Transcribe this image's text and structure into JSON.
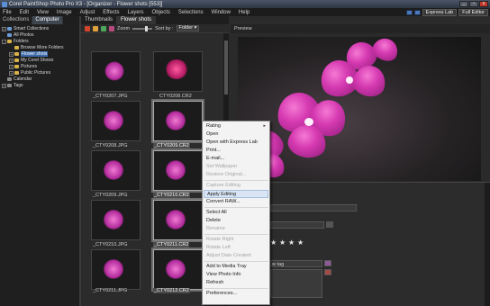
{
  "window": {
    "title": "Corel PaintShop Photo Pro X3 - [Organizer - Flower shots [553]]",
    "controls": [
      "_",
      "▫",
      "x"
    ]
  },
  "menu": {
    "items": [
      "File",
      "Edit",
      "View",
      "Image",
      "Adjust",
      "Effects",
      "Layers",
      "Objects",
      "Selections",
      "Window",
      "Help"
    ],
    "modes": [
      "Express Lab",
      "Full Editor"
    ]
  },
  "left_tabs": [
    "Collections",
    "Computer"
  ],
  "tree": [
    {
      "label": "Smart Collections",
      "expander": "+",
      "icon": "folder-icon"
    },
    {
      "label": "All Photos",
      "expander": "",
      "icon": "photos-icon"
    },
    {
      "label": "Folders",
      "expander": "-",
      "icon": "folder-icon"
    },
    {
      "label": "Browse More Folders",
      "expander": "",
      "icon": "folder-icon"
    },
    {
      "label": "Flower shots",
      "expander": "+",
      "icon": "folder-icon"
    },
    {
      "label": "My Corel Shows",
      "expander": "+",
      "icon": "folder-icon"
    },
    {
      "label": "Pictures",
      "expander": "+",
      "icon": "folder-icon"
    },
    {
      "label": "Public Pictures",
      "expander": "+",
      "icon": "folder-icon"
    },
    {
      "label": "Calendar",
      "expander": "",
      "icon": "calendar-icon"
    },
    {
      "label": "Tags",
      "expander": "+",
      "icon": "tag-icon"
    }
  ],
  "mid_tabs": [
    "Thumbnails",
    "Flower shots"
  ],
  "toolbar": {
    "zoom_label": "Zoom",
    "sort_label": "Sort by :",
    "sort_value": "Folder ▾"
  },
  "thumbnails": [
    {
      "caption": "_CTY0207.JPG",
      "selected": false
    },
    {
      "caption": "CTY0208.CR2",
      "selected": false
    },
    {
      "caption": "_CTY0208.JPG",
      "selected": false
    },
    {
      "caption": "_CTY0209.CR2",
      "selected": true
    },
    {
      "caption": "_CTY0209.JPG",
      "selected": false
    },
    {
      "caption": "_CTY0210.CR2",
      "selected": true
    },
    {
      "caption": "_CTY0210.JPG",
      "selected": false
    },
    {
      "caption": "_CTY0211.CR2",
      "selected": true
    },
    {
      "caption": "_CTY0211.JPG",
      "selected": false
    },
    {
      "caption": "_CTY0212.CR2",
      "selected": true
    }
  ],
  "preview": {
    "label": "Preview"
  },
  "info": {
    "tag_placeholder": "w tag",
    "rating_stars": 5
  },
  "context_menu": [
    {
      "label": "Rating",
      "disabled": false,
      "submenu": true
    },
    {
      "label": "Open",
      "disabled": false
    },
    {
      "label": "Open with Express Lab",
      "disabled": false
    },
    {
      "label": "Print...",
      "disabled": false
    },
    {
      "label": "E-mail...",
      "disabled": false
    },
    {
      "label": "Set Wallpaper",
      "disabled": true
    },
    {
      "label": "Restore Original...",
      "disabled": true
    },
    {
      "separator": true
    },
    {
      "label": "Capture Editing",
      "disabled": true
    },
    {
      "label": "Apply Editing",
      "disabled": false,
      "highlight": true
    },
    {
      "label": "Convert RAW...",
      "disabled": false
    },
    {
      "separator": true
    },
    {
      "label": "Select All",
      "disabled": false
    },
    {
      "label": "Delete",
      "disabled": false
    },
    {
      "label": "Rename",
      "disabled": true
    },
    {
      "separator": true
    },
    {
      "label": "Rotate Right",
      "disabled": true
    },
    {
      "label": "Rotate Left",
      "disabled": true
    },
    {
      "label": "Adjust Date Created",
      "disabled": true
    },
    {
      "separator": true
    },
    {
      "label": "Add to Media Tray",
      "disabled": false
    },
    {
      "label": "View Photo Info",
      "disabled": false
    },
    {
      "label": "Refresh",
      "disabled": false
    },
    {
      "separator": true
    },
    {
      "label": "Preferences...",
      "disabled": false
    }
  ]
}
